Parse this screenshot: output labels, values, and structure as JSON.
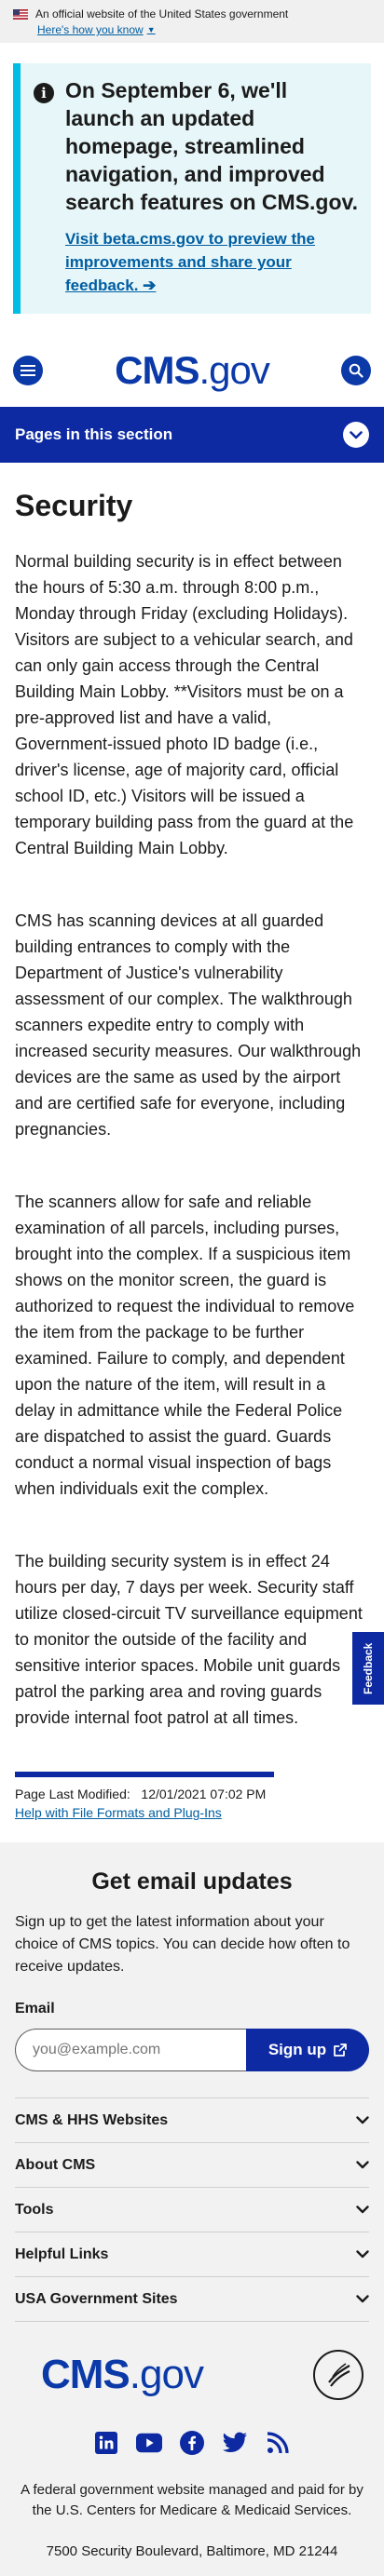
{
  "gov_banner": {
    "text": "An official website of the United States government",
    "link": "Here's how you know"
  },
  "alert": {
    "heading": "On September 6, we'll launch an updated homepage, streamlined navigation, and improved search features on CMS.gov.",
    "link": "Visit beta.cms.gov to preview the improvements and share your feedback. ➔"
  },
  "header": {
    "logo_main": "CMS",
    "logo_suffix": ".gov",
    "menu_icon": "menu-icon",
    "search_icon": "search-icon"
  },
  "section_nav": {
    "label": "Pages in this section"
  },
  "main": {
    "title": "Security",
    "paragraphs": [
      "Normal building security is in effect between the hours of 5:30 a.m. through 8:00 p.m., Monday through Friday (excluding Holidays). Visitors are subject to a vehicular search, and can only gain access through the Central Building Main Lobby. **Visitors must be on a pre-approved list and have a valid, Government-issued photo ID badge (i.e., driver's license, age of majority card, official school ID, etc.) Visitors will be issued a temporary building pass from the guard at the Central Building Main Lobby.",
      "CMS has scanning devices at all guarded building entrances to comply with the Department of Justice's vulnerability assessment of our complex. The walkthrough scanners expedite entry to comply with increased security measures. Our walkthrough devices are the same as used by the airport and are certified safe for everyone, including pregnancies.",
      "The scanners allow for safe and reliable examination of all parcels, including purses, brought into the complex. If a suspicious item shows on the monitor screen, the guard is authorized to request the individual to remove the item from the package to be further examined. Failure to comply, and dependent upon the nature of the item, will result in a delay in admittance while the Federal Police are dispatched to assist the guard. Guards conduct a normal visual inspection of bags when individuals exit the complex.",
      "The building security system is in effect 24 hours per day, 7 days per week. Security staff utilize closed-circuit TV surveillance equipment to monitor the outside of the facility and sensitive interior spaces. Mobile unit guards patrol the parking area and roving guards provide internal foot patrol at all times."
    ],
    "last_modified_label": "Page Last Modified:",
    "last_modified_value": "12/01/2021 07:02 PM",
    "help_link": "Help with File Formats and Plug-Ins"
  },
  "feedback_tab": "Feedback",
  "email_signup": {
    "heading": "Get email updates",
    "description": "Sign up to get the latest information about your choice of CMS topics. You can decide how often to receive updates.",
    "email_label": "Email",
    "email_placeholder": "you@example.com",
    "button_label": "Sign up"
  },
  "footer_accordion": [
    {
      "label": "CMS & HHS Websites"
    },
    {
      "label": "About CMS"
    },
    {
      "label": "Tools"
    },
    {
      "label": "Helpful Links"
    },
    {
      "label": "USA Government Sites"
    }
  ],
  "footer": {
    "logo_main": "CMS",
    "logo_suffix": ".gov",
    "social_icons": [
      "linkedin-icon",
      "youtube-icon",
      "facebook-icon",
      "twitter-icon",
      "rss-icon"
    ],
    "managed_text": "A federal government website managed and paid for by the U.S. Centers for Medicare & Medicaid Services.",
    "address": "7500 Security Boulevard, Baltimore, MD 21244"
  },
  "colors": {
    "brand_blue": "#0d2aa3",
    "logo_blue": "#0b3aa8",
    "alert_bg": "#e7f6f8",
    "alert_border": "#00bde3",
    "link": "#005ea2"
  }
}
